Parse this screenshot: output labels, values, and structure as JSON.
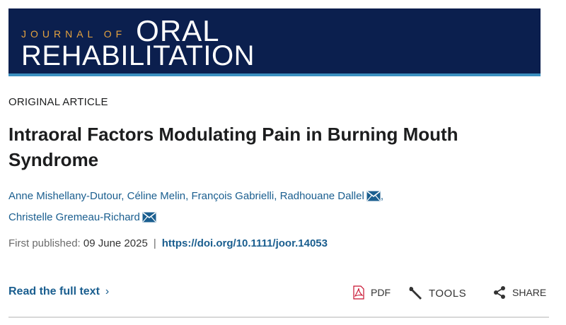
{
  "journal": {
    "logo_prefix": "JOURNAL OF",
    "logo_word1": "ORAL",
    "logo_word2": "REHABILITATION"
  },
  "article": {
    "type": "ORIGINAL ARTICLE",
    "title": "Intraoral Factors Modulating Pain in Burning Mouth Syndrome",
    "authors": [
      {
        "name": "Anne Mishellany-Dutour",
        "sep": ", "
      },
      {
        "name": "Céline Melin",
        "sep": ", "
      },
      {
        "name": "François Gabrielli",
        "sep": ", "
      },
      {
        "name": "Radhouane Dallel",
        "sep": ","
      },
      {
        "name": "Christelle Gremeau-Richard",
        "sep": ""
      }
    ],
    "published_label": "First published:",
    "published_date": "09 June 2025",
    "separator": "|",
    "doi": "https://doi.org/10.1111/joor.14053"
  },
  "actions": {
    "read_full": "Read the full text",
    "read_full_chevron": "›",
    "pdf_label": "PDF",
    "tools_label": "TOOLS",
    "share_label": "SHARE"
  },
  "icons": {
    "pdf": "pdf-file-icon",
    "tools": "wrench-icon",
    "share": "share-icon",
    "email": "envelope-icon"
  },
  "colors": {
    "banner": "#0b1f4e",
    "banner_rule": "#3b8fbf",
    "logo_accent": "#e4a23f",
    "link": "#1a5e8f",
    "pdf_red": "#c8102e"
  }
}
